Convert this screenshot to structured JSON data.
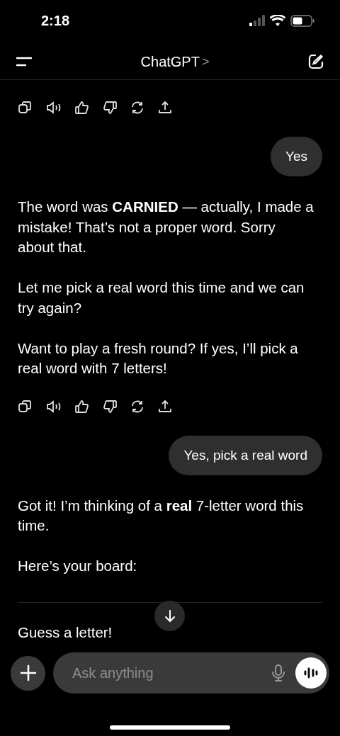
{
  "status_bar": {
    "time": "2:18"
  },
  "header": {
    "title": "ChatGPT",
    "chevron": ">"
  },
  "messages": [
    {
      "kind": "actions"
    },
    {
      "kind": "user",
      "text": "Yes"
    },
    {
      "kind": "text",
      "text": "The word was **CARNIED** — actually, I made a mistake! That’s not a proper word. Sorry about that."
    },
    {
      "kind": "text",
      "text": "Let me pick a real word this time and we can try again?"
    },
    {
      "kind": "text",
      "text": "Want to play a fresh round? If yes, I’ll pick a real word with 7 letters!"
    },
    {
      "kind": "actions"
    },
    {
      "kind": "user",
      "text": "Yes, pick a real word"
    },
    {
      "kind": "text",
      "text": "Got it! I’m thinking of a **real** 7-letter word this time."
    },
    {
      "kind": "text",
      "text": "Here’s your board:"
    },
    {
      "kind": "rule"
    },
    {
      "kind": "text",
      "text": "Guess a letter!"
    }
  ],
  "composer": {
    "placeholder": "Ask anything"
  }
}
